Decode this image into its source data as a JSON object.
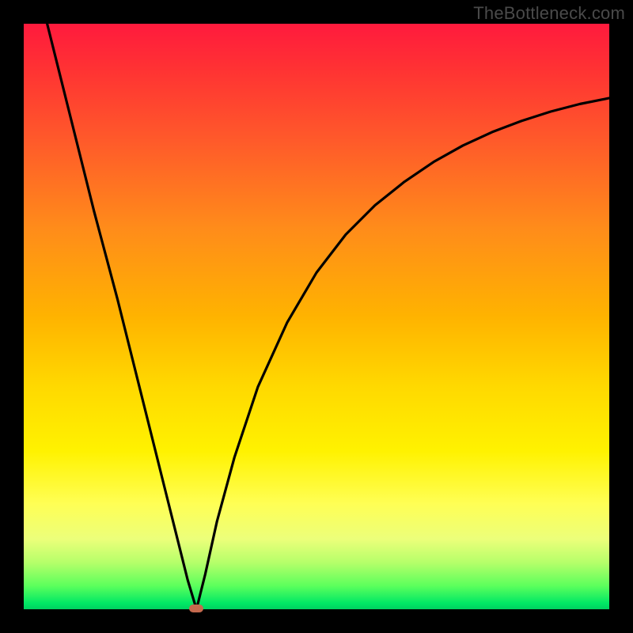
{
  "watermark": "TheBottleneck.com",
  "colors": {
    "frame": "#000000",
    "gradient_top": "#ff1a3d",
    "gradient_bottom": "#00d060",
    "curve": "#000000",
    "marker": "#c5694e",
    "watermark_text": "#4a4a4a"
  },
  "chart_data": {
    "type": "line",
    "title": "",
    "xlabel": "",
    "ylabel": "",
    "xlim": [
      0,
      100
    ],
    "ylim": [
      0,
      100
    ],
    "grid": false,
    "legend": false,
    "series": [
      {
        "name": "left-branch",
        "x": [
          4,
          6,
          8,
          10,
          12,
          14,
          16,
          18,
          20,
          22,
          24,
          26,
          28,
          29.5
        ],
        "y": [
          100,
          92,
          84,
          76,
          68,
          60.5,
          53,
          45,
          37,
          29,
          21,
          13,
          5,
          0
        ]
      },
      {
        "name": "right-branch",
        "x": [
          29.5,
          31,
          33,
          36,
          40,
          45,
          50,
          55,
          60,
          65,
          70,
          75,
          80,
          85,
          90,
          95,
          100
        ],
        "y": [
          0,
          6,
          15,
          26,
          38,
          49,
          57.5,
          64,
          69,
          73,
          76.4,
          79.2,
          81.5,
          83.4,
          85,
          86.3,
          87.3
        ]
      }
    ],
    "minimum_point": {
      "x": 29.5,
      "y": 0
    },
    "annotations": [
      {
        "text": "TheBottleneck.com",
        "pos": "top-right"
      }
    ]
  }
}
